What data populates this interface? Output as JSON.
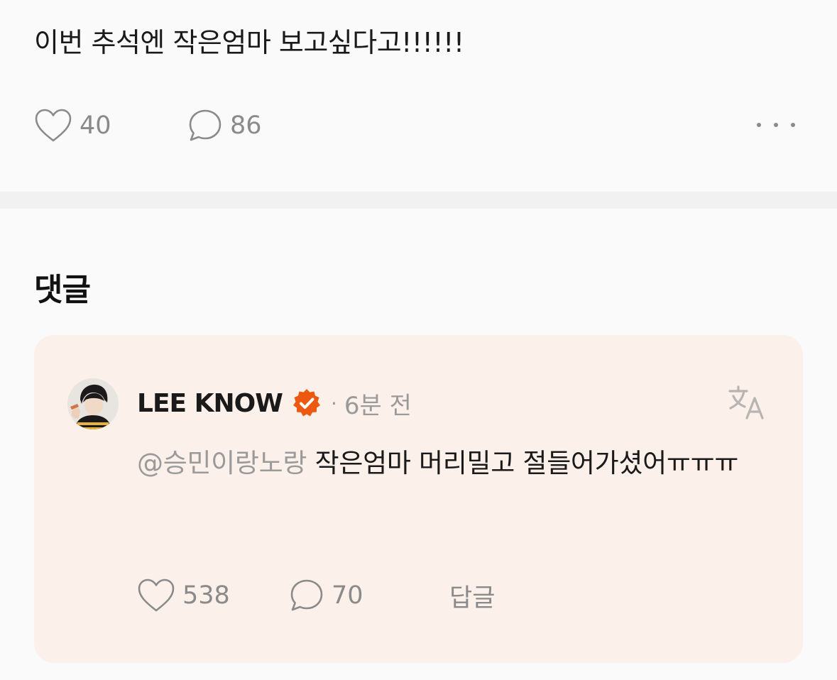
{
  "post": {
    "text": "이번 추석엔 작은엄마 보고싶다고!!!!!!",
    "like_count": "40",
    "comment_count": "86",
    "more_icon": "more-horizontal-icon"
  },
  "comments_section": {
    "title": "댓글"
  },
  "comment": {
    "author": "LEE KNOW",
    "verified_icon": "verified-badge-icon",
    "verified_color": "#ec5a11",
    "separator": "·",
    "time_ago": "6분 전",
    "translate_icon": "translate-icon",
    "mention": "@승민이랑노랑",
    "body": "작은엄마 머리밀고 절들어가셨어ㅠㅠㅠ",
    "like_count": "538",
    "reply_count": "70",
    "reply_label": "답글"
  },
  "colors": {
    "background": "#fafafa",
    "card_background": "#fcf0ea",
    "muted_text": "#8a8a8a",
    "badge_orange": "#ec5a11"
  }
}
